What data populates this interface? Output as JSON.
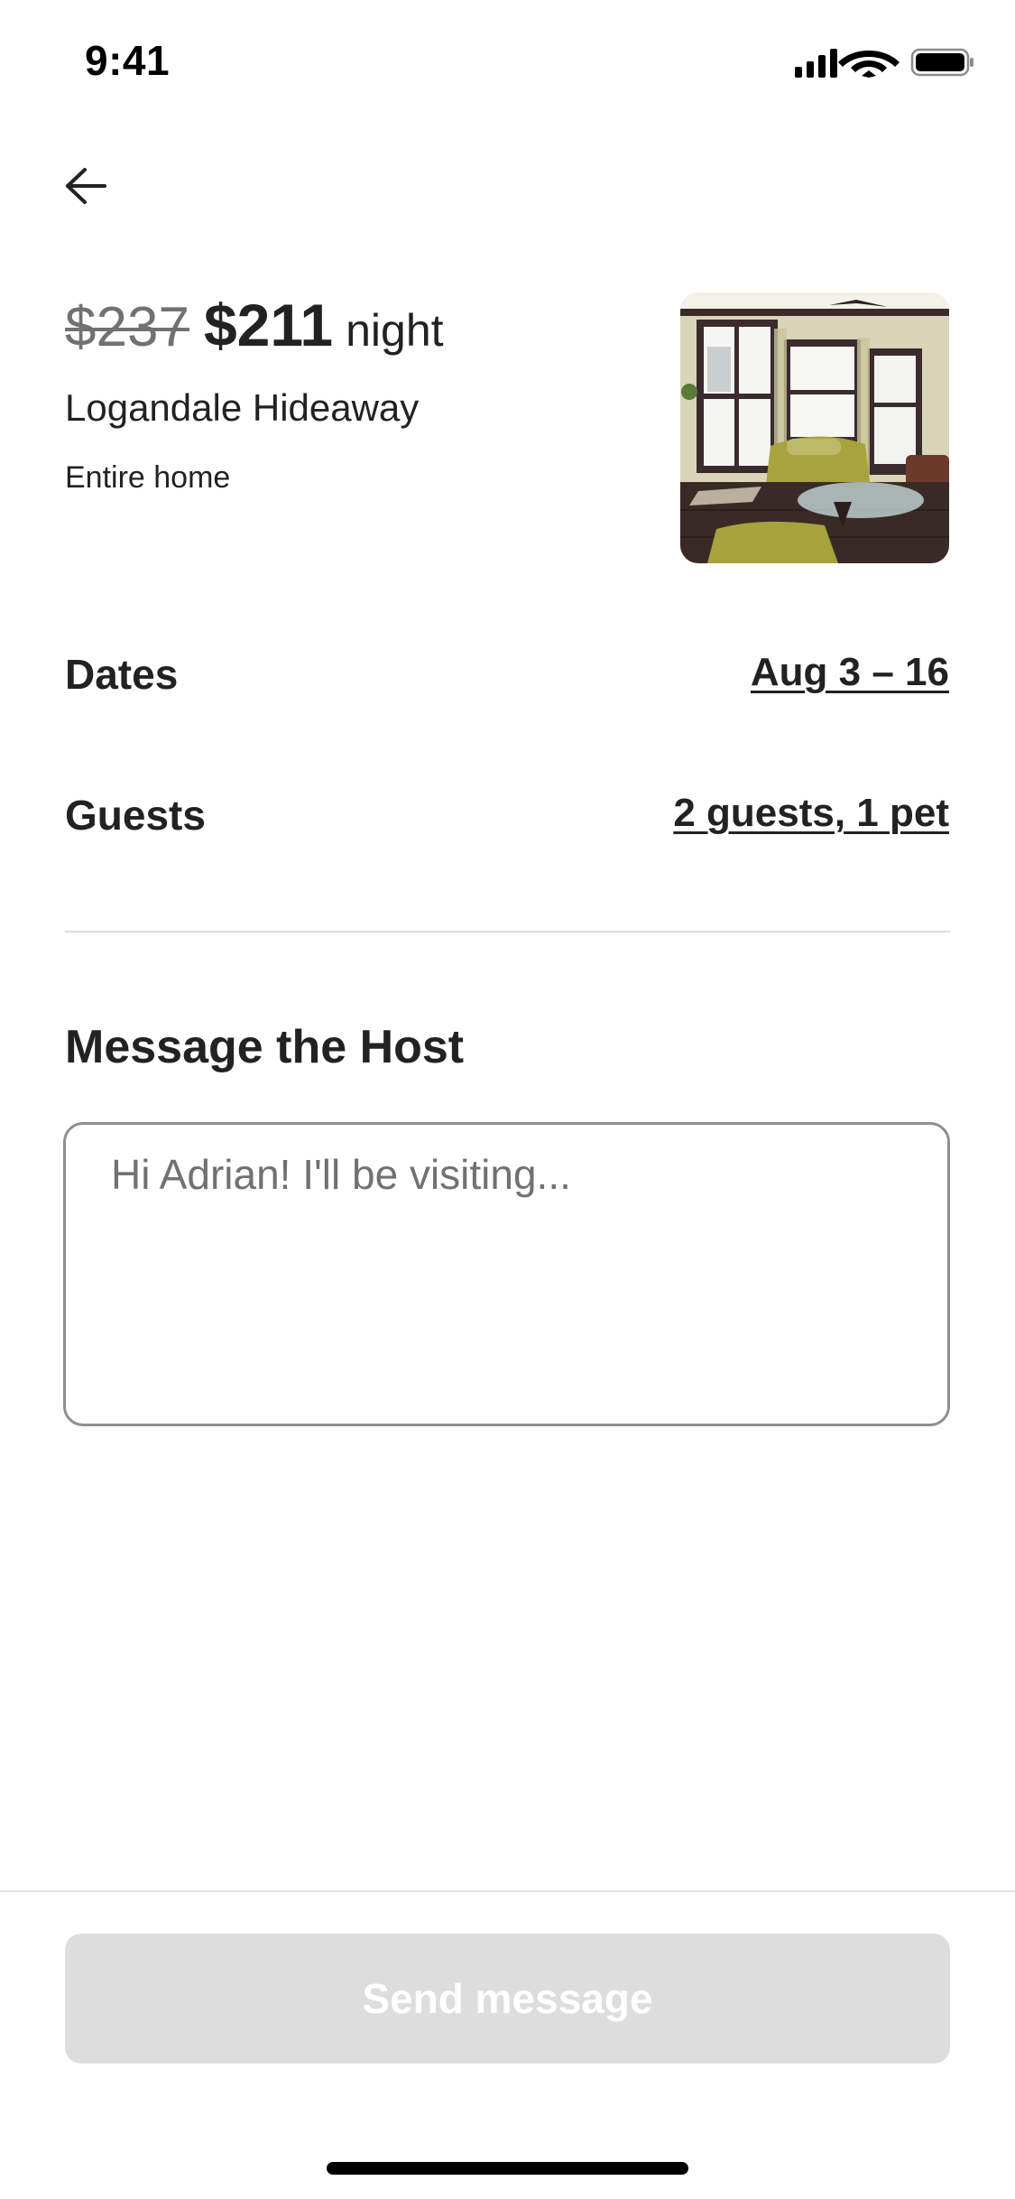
{
  "status_bar": {
    "time": "9:41",
    "icons": [
      "cellular-signal-icon",
      "wifi-icon",
      "battery-icon"
    ]
  },
  "nav": {
    "back_icon": "arrow-left-icon"
  },
  "listing": {
    "original_price": "$237",
    "current_price": "$211",
    "price_unit": "night",
    "name": "Logandale Hideaway",
    "type": "Entire home",
    "photo_description": "living room photo"
  },
  "trip": {
    "dates_label": "Dates",
    "dates_value": "Aug 3 – 16",
    "guests_label": "Guests",
    "guests_value": "2 guests, 1 pet"
  },
  "message": {
    "title": "Message the Host",
    "placeholder": "Hi Adrian! I'll be visiting...",
    "value": ""
  },
  "footer": {
    "send_label": "Send message",
    "send_enabled": false
  },
  "colors": {
    "text_primary": "#222222",
    "text_secondary": "#717171",
    "button_disabled_bg": "#dddddd",
    "divider": "#dddddd"
  }
}
